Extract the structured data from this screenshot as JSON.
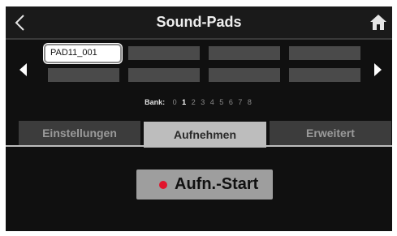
{
  "header": {
    "title": "Sound-Pads",
    "back_icon": "chevron-left-icon",
    "home_icon": "home-icon"
  },
  "pads": {
    "selected_label": "PAD11_001",
    "prev_icon": "triangle-left-icon",
    "next_icon": "triangle-right-icon"
  },
  "bank": {
    "label": "Bank:",
    "numbers": [
      "0",
      "1",
      "2",
      "3",
      "4",
      "5",
      "6",
      "7",
      "8"
    ],
    "active": "1"
  },
  "tabs": [
    {
      "label": "Einstellungen",
      "active": false
    },
    {
      "label": "Aufnehmen",
      "active": true
    },
    {
      "label": "Erweitert",
      "active": false
    }
  ],
  "record": {
    "label": "Aufn.-Start",
    "icon": "record-dot-icon",
    "dot_color": "#e0142c"
  },
  "colors": {
    "screen_bg": "#101010",
    "pad_empty": "#4a4a4a",
    "tab_active": "#bdbdbd",
    "tab_inactive": "#3c3c3c",
    "button_bg": "#9e9e9e"
  }
}
